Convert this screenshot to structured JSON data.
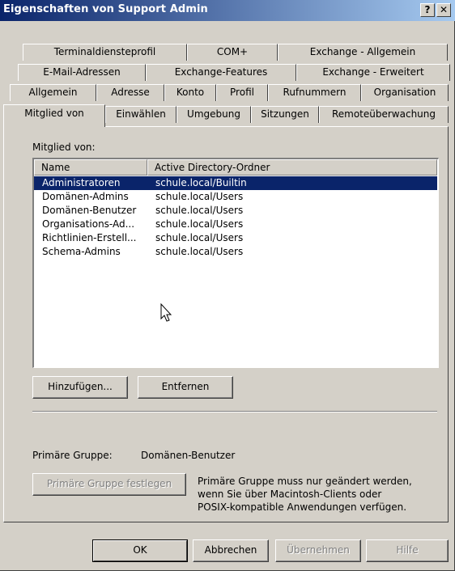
{
  "window": {
    "title": "Eigenschaften von Support Admin",
    "help_label": "?",
    "close_label": "✕"
  },
  "tabs": {
    "row1": [
      "Terminaldiensteprofil",
      "COM+",
      "Exchange - Allgemein"
    ],
    "row2": [
      "E-Mail-Adressen",
      "Exchange-Features",
      "Exchange - Erweitert"
    ],
    "row3": [
      "Allgemein",
      "Adresse",
      "Konto",
      "Profil",
      "Rufnummern",
      "Organisation"
    ],
    "row4": [
      "Mitglied von",
      "Einwählen",
      "Umgebung",
      "Sitzungen",
      "Remoteüberwachung"
    ]
  },
  "member": {
    "label": "Mitglied von:",
    "columns": [
      "Name",
      "Active Directory-Ordner"
    ],
    "rows": [
      {
        "name": "Administratoren",
        "folder": "schule.local/Builtin"
      },
      {
        "name": "Domänen-Admins",
        "folder": "schule.local/Users"
      },
      {
        "name": "Domänen-Benutzer",
        "folder": "schule.local/Users"
      },
      {
        "name": "Organisations-Ad...",
        "folder": "schule.local/Users"
      },
      {
        "name": "Richtlinien-Erstell...",
        "folder": "schule.local/Users"
      },
      {
        "name": "Schema-Admins",
        "folder": "schule.local/Users"
      }
    ],
    "add_label": "Hinzufügen...",
    "remove_label": "Entfernen"
  },
  "primary": {
    "label": "Primäre Gruppe:",
    "value": "Domänen-Benutzer",
    "set_label": "Primäre Gruppe festlegen",
    "note_line1": "Primäre Gruppe muss nur geändert werden,",
    "note_line2": "wenn Sie über Macintosh-Clients oder",
    "note_line3": "POSIX-kompatible Anwendungen verfügen."
  },
  "footer": {
    "ok": "OK",
    "cancel": "Abbrechen",
    "apply": "Übernehmen",
    "help": "Hilfe"
  }
}
